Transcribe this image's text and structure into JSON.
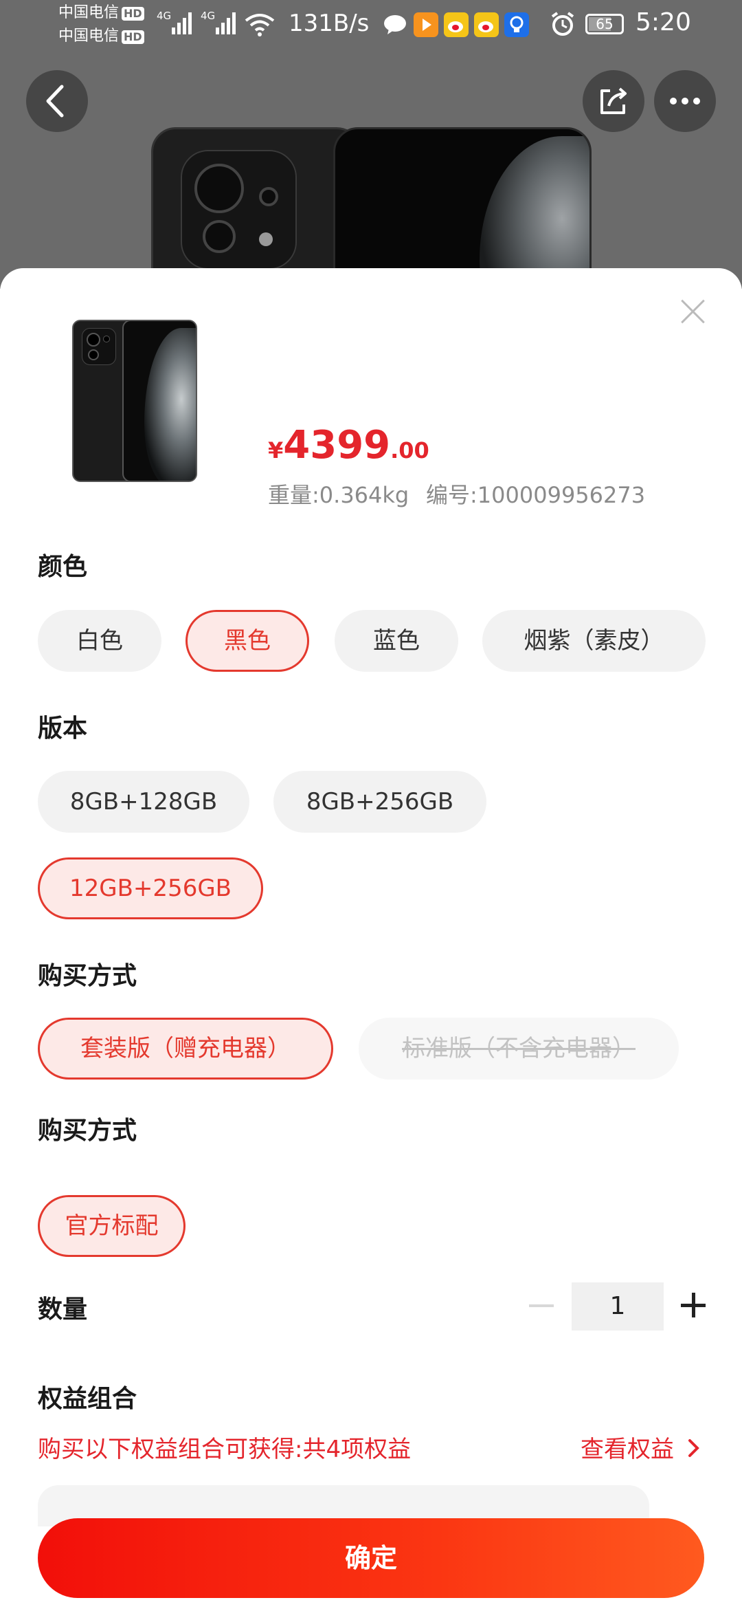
{
  "status_bar": {
    "carrier1": "中国电信",
    "carrier2": "中国电信",
    "hd": "HD",
    "network": "4G",
    "net_speed": "131B/s",
    "battery": "65",
    "time": "5:20",
    "icons": [
      "signal-bars-icon",
      "wifi-icon",
      "wechat-icon",
      "video-app-icon",
      "weibo-icon",
      "weibo-icon",
      "bulb-app-icon",
      "alarm-icon",
      "battery-icon"
    ]
  },
  "header": {
    "back_icon": "chevron-left-icon",
    "share_icon": "share-icon",
    "more_icon": "more-dots-icon"
  },
  "product": {
    "currency": "¥",
    "price_int": "4399",
    "price_dec": ".00",
    "weight": "重量:0.364kg",
    "sku": "编号:100009956273"
  },
  "sections": {
    "color": {
      "title": "颜色",
      "options": [
        "白色",
        "黑色",
        "蓝色",
        "烟紫（素皮）"
      ],
      "selected": "黑色"
    },
    "version": {
      "title": "版本",
      "options": [
        "8GB+128GB",
        "8GB+256GB",
        "12GB+256GB"
      ],
      "selected": "12GB+256GB"
    },
    "purchase": {
      "title": "购买方式",
      "options": [
        "套装版（赠充电器）",
        "标准版（不含充电器）"
      ],
      "selected": "套装版（赠充电器）",
      "disabled": "标准版（不含充电器）"
    },
    "purchase2": {
      "title": "购买方式",
      "options": [
        "官方标配"
      ],
      "selected": "官方标配"
    },
    "quantity": {
      "title": "数量",
      "value": "1"
    },
    "benefits": {
      "title": "权益组合",
      "text": "购买以下权益组合可获得:共4项权益",
      "link": "查看权益",
      "link_icon": "chevron-right-icon"
    }
  },
  "confirm_label": "确定",
  "colors": {
    "accent": "#e4252c",
    "selected_bg": "#fde9e7",
    "chip_bg": "#f2f2f2",
    "button_start": "#f20f0a",
    "button_end": "#ff5a1f"
  }
}
